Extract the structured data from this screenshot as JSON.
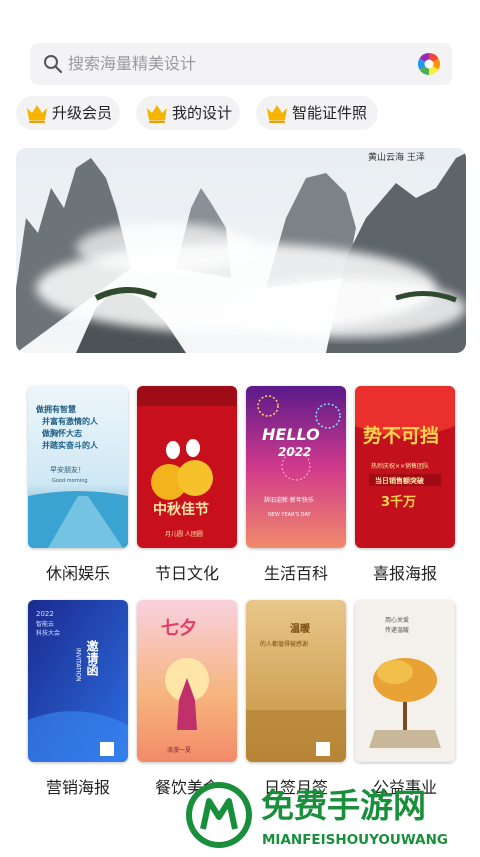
{
  "search": {
    "placeholder": "搜索海量精美设计"
  },
  "chips": [
    {
      "label": "升级会员"
    },
    {
      "label": "我的设计"
    },
    {
      "label": "智能证件照"
    }
  ],
  "banner": {
    "signature": "黄山云海 王泽"
  },
  "categories": [
    {
      "label": "休闲娱乐"
    },
    {
      "label": "节日文化"
    },
    {
      "label": "生活百科"
    },
    {
      "label": "喜报海报"
    },
    {
      "label": "营销海报"
    },
    {
      "label": "餐饮美食"
    },
    {
      "label": "日签月签"
    },
    {
      "label": "公益事业"
    }
  ],
  "cards": {
    "card1": {
      "l1": "做拥有智慧",
      "l2": "并富有激情的人",
      "l3": "做胸怀大志",
      "l4": "并踏实奋斗的人",
      "sign": "早安朋友！",
      "sub": "Good morning"
    },
    "card2": {
      "title": "中秋佳节",
      "sub": "月儿圆 人团圆"
    },
    "card3": {
      "hello": "HELLO",
      "year": "2022",
      "line": "辞旧迎新·新年快乐",
      "en": "NEW YEAR'S DAY"
    },
    "card4": {
      "big": "势不可挡",
      "team": "热烈庆祝××销售团队",
      "line": "当日销售额突破",
      "amt": "3千万"
    },
    "card5": {
      "year": "2022",
      "meet": "智能云",
      "tech": "科技大会",
      "title": "邀请函",
      "en": "INVITATION"
    },
    "card6": {
      "title": "七夕",
      "sub": "浪漫一夏"
    },
    "card7": {
      "title": "温暖",
      "sub": "的人都值得被感谢"
    },
    "card8": {
      "t1": "用心关爱",
      "t2": "传递温暖"
    }
  },
  "watermark": {
    "title": "免费手游网",
    "sub": "MIANFEISHOUYOUWANG"
  },
  "colors": {
    "accent_crown": "#f5b400",
    "chip_bg": "#f3f3f5",
    "search_bg": "#f3f3f5"
  }
}
